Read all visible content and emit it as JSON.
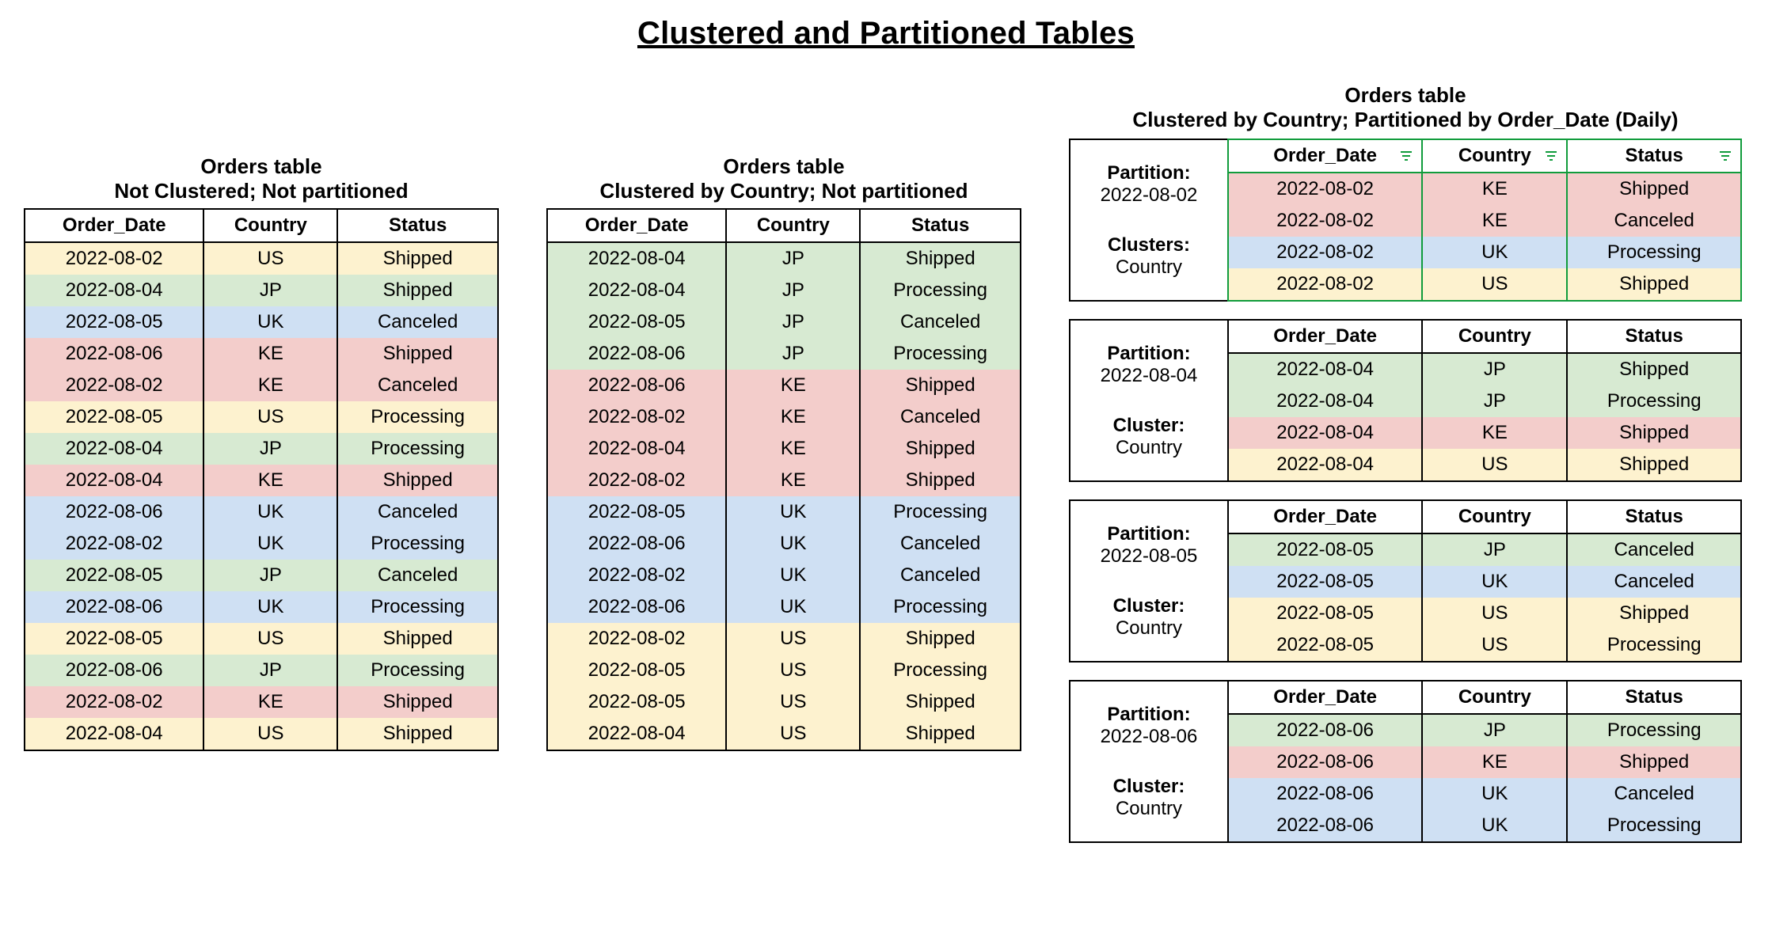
{
  "title": "Clustered and Partitioned Tables",
  "columns": {
    "c1": "Order_Date",
    "c2": "Country",
    "c3": "Status"
  },
  "table1": {
    "title": "Orders table",
    "subtitle": "Not Clustered; Not partitioned",
    "rows": [
      {
        "date": "2022-08-02",
        "country": "US",
        "status": "Shipped",
        "color": "yellow"
      },
      {
        "date": "2022-08-04",
        "country": "JP",
        "status": "Shipped",
        "color": "green"
      },
      {
        "date": "2022-08-05",
        "country": "UK",
        "status": "Canceled",
        "color": "blue"
      },
      {
        "date": "2022-08-06",
        "country": "KE",
        "status": "Shipped",
        "color": "red"
      },
      {
        "date": "2022-08-02",
        "country": "KE",
        "status": "Canceled",
        "color": "red"
      },
      {
        "date": "2022-08-05",
        "country": "US",
        "status": "Processing",
        "color": "yellow"
      },
      {
        "date": "2022-08-04",
        "country": "JP",
        "status": "Processing",
        "color": "green"
      },
      {
        "date": "2022-08-04",
        "country": "KE",
        "status": "Shipped",
        "color": "red"
      },
      {
        "date": "2022-08-06",
        "country": "UK",
        "status": "Canceled",
        "color": "blue"
      },
      {
        "date": "2022-08-02",
        "country": "UK",
        "status": "Processing",
        "color": "blue"
      },
      {
        "date": "2022-08-05",
        "country": "JP",
        "status": "Canceled",
        "color": "green"
      },
      {
        "date": "2022-08-06",
        "country": "UK",
        "status": "Processing",
        "color": "blue"
      },
      {
        "date": "2022-08-05",
        "country": "US",
        "status": "Shipped",
        "color": "yellow"
      },
      {
        "date": "2022-08-06",
        "country": "JP",
        "status": "Processing",
        "color": "green"
      },
      {
        "date": "2022-08-02",
        "country": "KE",
        "status": "Shipped",
        "color": "red"
      },
      {
        "date": "2022-08-04",
        "country": "US",
        "status": "Shipped",
        "color": "yellow"
      }
    ]
  },
  "table2": {
    "title": "Orders table",
    "subtitle": "Clustered by Country; Not partitioned",
    "rows": [
      {
        "date": "2022-08-04",
        "country": "JP",
        "status": "Shipped",
        "color": "green"
      },
      {
        "date": "2022-08-04",
        "country": "JP",
        "status": "Processing",
        "color": "green"
      },
      {
        "date": "2022-08-05",
        "country": "JP",
        "status": "Canceled",
        "color": "green"
      },
      {
        "date": "2022-08-06",
        "country": "JP",
        "status": "Processing",
        "color": "green"
      },
      {
        "date": "2022-08-06",
        "country": "KE",
        "status": "Shipped",
        "color": "red"
      },
      {
        "date": "2022-08-02",
        "country": "KE",
        "status": "Canceled",
        "color": "red"
      },
      {
        "date": "2022-08-04",
        "country": "KE",
        "status": "Shipped",
        "color": "red"
      },
      {
        "date": "2022-08-02",
        "country": "KE",
        "status": "Shipped",
        "color": "red"
      },
      {
        "date": "2022-08-05",
        "country": "UK",
        "status": "Processing",
        "color": "blue"
      },
      {
        "date": "2022-08-06",
        "country": "UK",
        "status": "Canceled",
        "color": "blue"
      },
      {
        "date": "2022-08-02",
        "country": "UK",
        "status": "Canceled",
        "color": "blue"
      },
      {
        "date": "2022-08-06",
        "country": "UK",
        "status": "Processing",
        "color": "blue"
      },
      {
        "date": "2022-08-02",
        "country": "US",
        "status": "Shipped",
        "color": "yellow"
      },
      {
        "date": "2022-08-05",
        "country": "US",
        "status": "Processing",
        "color": "yellow"
      },
      {
        "date": "2022-08-05",
        "country": "US",
        "status": "Shipped",
        "color": "yellow"
      },
      {
        "date": "2022-08-04",
        "country": "US",
        "status": "Shipped",
        "color": "yellow"
      }
    ]
  },
  "table3": {
    "title": "Orders table",
    "subtitle": "Clustered by Country; Partitioned by Order_Date (Daily)",
    "side": {
      "partition_label": "Partition:",
      "clusters_label_plural": "Clusters:",
      "cluster_label_singular": "Cluster:",
      "cluster_value": "Country"
    },
    "partitions": [
      {
        "value": "2022-08-02",
        "clusters_plural": true,
        "rows": [
          {
            "date": "2022-08-02",
            "country": "KE",
            "status": "Shipped",
            "color": "red"
          },
          {
            "date": "2022-08-02",
            "country": "KE",
            "status": "Canceled",
            "color": "red"
          },
          {
            "date": "2022-08-02",
            "country": "UK",
            "status": "Processing",
            "color": "blue"
          },
          {
            "date": "2022-08-02",
            "country": "US",
            "status": "Shipped",
            "color": "yellow"
          }
        ]
      },
      {
        "value": "2022-08-04",
        "clusters_plural": false,
        "rows": [
          {
            "date": "2022-08-04",
            "country": "JP",
            "status": "Shipped",
            "color": "green"
          },
          {
            "date": "2022-08-04",
            "country": "JP",
            "status": "Processing",
            "color": "green"
          },
          {
            "date": "2022-08-04",
            "country": "KE",
            "status": "Shipped",
            "color": "red"
          },
          {
            "date": "2022-08-04",
            "country": "US",
            "status": "Shipped",
            "color": "yellow"
          }
        ]
      },
      {
        "value": "2022-08-05",
        "clusters_plural": false,
        "rows": [
          {
            "date": "2022-08-05",
            "country": "JP",
            "status": "Canceled",
            "color": "green"
          },
          {
            "date": "2022-08-05",
            "country": "UK",
            "status": "Canceled",
            "color": "blue"
          },
          {
            "date": "2022-08-05",
            "country": "US",
            "status": "Shipped",
            "color": "yellow"
          },
          {
            "date": "2022-08-05",
            "country": "US",
            "status": "Processing",
            "color": "yellow"
          }
        ]
      },
      {
        "value": "2022-08-06",
        "clusters_plural": false,
        "rows": [
          {
            "date": "2022-08-06",
            "country": "JP",
            "status": "Processing",
            "color": "green"
          },
          {
            "date": "2022-08-06",
            "country": "KE",
            "status": "Shipped",
            "color": "red"
          },
          {
            "date": "2022-08-06",
            "country": "UK",
            "status": "Canceled",
            "color": "blue"
          },
          {
            "date": "2022-08-06",
            "country": "UK",
            "status": "Processing",
            "color": "blue"
          }
        ]
      }
    ]
  }
}
